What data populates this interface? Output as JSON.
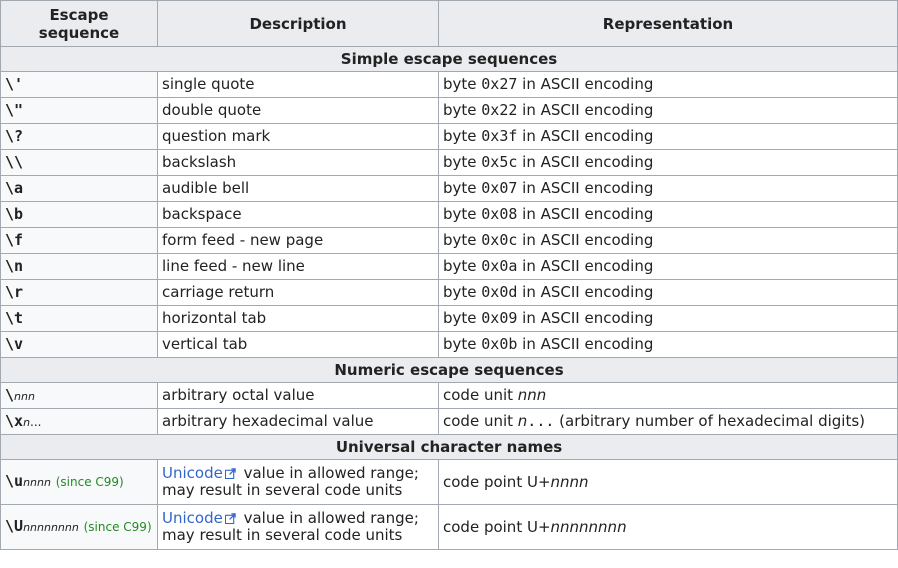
{
  "header": {
    "col1": "Escape sequence",
    "col2": "Description",
    "col3": "Representation"
  },
  "sections": {
    "simple": "Simple escape sequences",
    "numeric": "Numeric escape sequences",
    "universal": "Universal character names"
  },
  "simple_rows": [
    {
      "seq": "\\'",
      "desc": "single quote",
      "rep_pre": "byte ",
      "rep_code": "0x27",
      "rep_post": " in ASCII encoding"
    },
    {
      "seq": "\\\"",
      "desc": "double quote",
      "rep_pre": "byte ",
      "rep_code": "0x22",
      "rep_post": " in ASCII encoding"
    },
    {
      "seq": "\\?",
      "desc": "question mark",
      "rep_pre": "byte ",
      "rep_code": "0x3f",
      "rep_post": " in ASCII encoding"
    },
    {
      "seq": "\\\\",
      "desc": "backslash",
      "rep_pre": "byte ",
      "rep_code": "0x5c",
      "rep_post": " in ASCII encoding"
    },
    {
      "seq": "\\a",
      "desc": "audible bell",
      "rep_pre": "byte ",
      "rep_code": "0x07",
      "rep_post": " in ASCII encoding"
    },
    {
      "seq": "\\b",
      "desc": "backspace",
      "rep_pre": "byte ",
      "rep_code": "0x08",
      "rep_post": " in ASCII encoding"
    },
    {
      "seq": "\\f",
      "desc": "form feed - new page",
      "rep_pre": "byte ",
      "rep_code": "0x0c",
      "rep_post": " in ASCII encoding"
    },
    {
      "seq": "\\n",
      "desc": "line feed - new line",
      "rep_pre": "byte ",
      "rep_code": "0x0a",
      "rep_post": " in ASCII encoding"
    },
    {
      "seq": "\\r",
      "desc": "carriage return",
      "rep_pre": "byte ",
      "rep_code": "0x0d",
      "rep_post": " in ASCII encoding"
    },
    {
      "seq": "\\t",
      "desc": "horizontal tab",
      "rep_pre": "byte ",
      "rep_code": "0x09",
      "rep_post": " in ASCII encoding"
    },
    {
      "seq": "\\v",
      "desc": "vertical tab",
      "rep_pre": "byte ",
      "rep_code": "0x0b",
      "rep_post": " in ASCII encoding"
    }
  ],
  "numeric_rows": {
    "octal": {
      "seq": "\\",
      "placeholder": "nnn",
      "desc": "arbitrary octal value",
      "rep_pre": "code unit ",
      "rep_ital": "nnn"
    },
    "hex": {
      "seq": "\\x",
      "placeholder": "n",
      "dots": "...",
      "desc": "arbitrary hexadecimal value",
      "rep_pre": "code unit ",
      "rep_ital": "n",
      "rep_code": "...",
      "rep_post": " (arbitrary number of hexadecimal digits)"
    }
  },
  "universal_rows": {
    "u4": {
      "seq": "\\u",
      "placeholder": "nnnn",
      "since": "(since C99)",
      "link": "Unicode",
      "desc_post": " value in allowed range;",
      "desc_line2": "may result in several code units",
      "rep_pre": "code point U+",
      "rep_ital": "nnnn"
    },
    "u8": {
      "seq": "\\U",
      "placeholder": "nnnnnnnn",
      "since": "(since C99)",
      "link": "Unicode",
      "desc_post": " value in allowed range;",
      "desc_line2": "may result in several code units",
      "rep_pre": "code point U+",
      "rep_ital": "nnnnnnnn"
    }
  },
  "icons": {
    "external_link": "external-link-icon"
  },
  "colors": {
    "link": "#3366cc",
    "since": "#228b22",
    "header_bg": "#eaecf0",
    "border": "#a2a9b1"
  }
}
